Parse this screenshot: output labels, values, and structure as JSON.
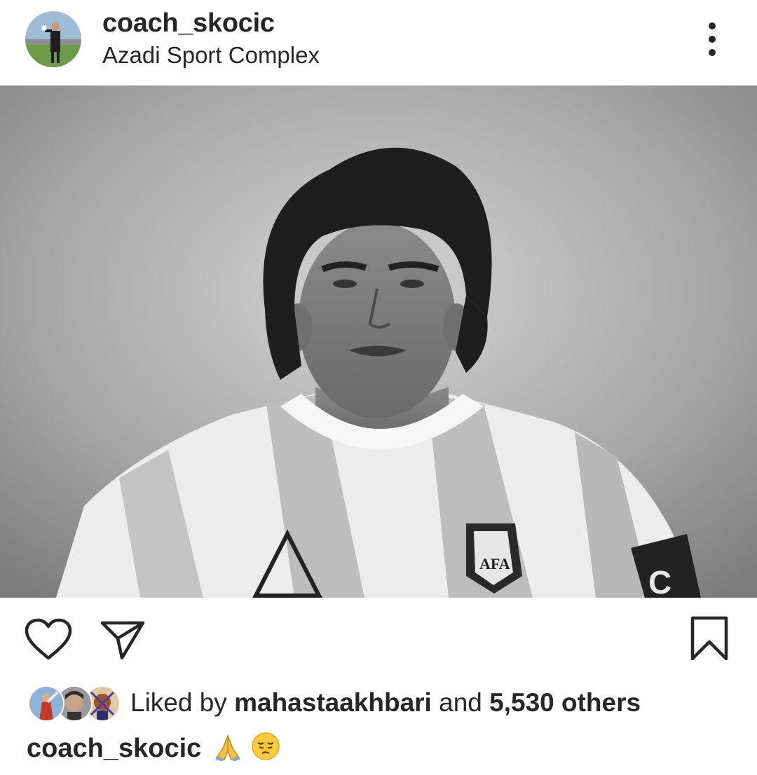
{
  "post": {
    "username": "coach_skocic",
    "location": "Azadi Sport Complex",
    "liked_by_prefix": "Liked by",
    "liked_by_user": "mahastaakhbari",
    "liked_and": "and",
    "liked_others": "5,530 others",
    "caption_user": "coach_skocic",
    "caption_emojis": [
      "folded-hands",
      "pensive-face"
    ]
  },
  "icons": {
    "more": "more-vertical-icon",
    "like": "heart-icon",
    "share": "send-icon",
    "save": "bookmark-icon"
  },
  "colors": {
    "text": "#262626",
    "background": "#ffffff"
  }
}
